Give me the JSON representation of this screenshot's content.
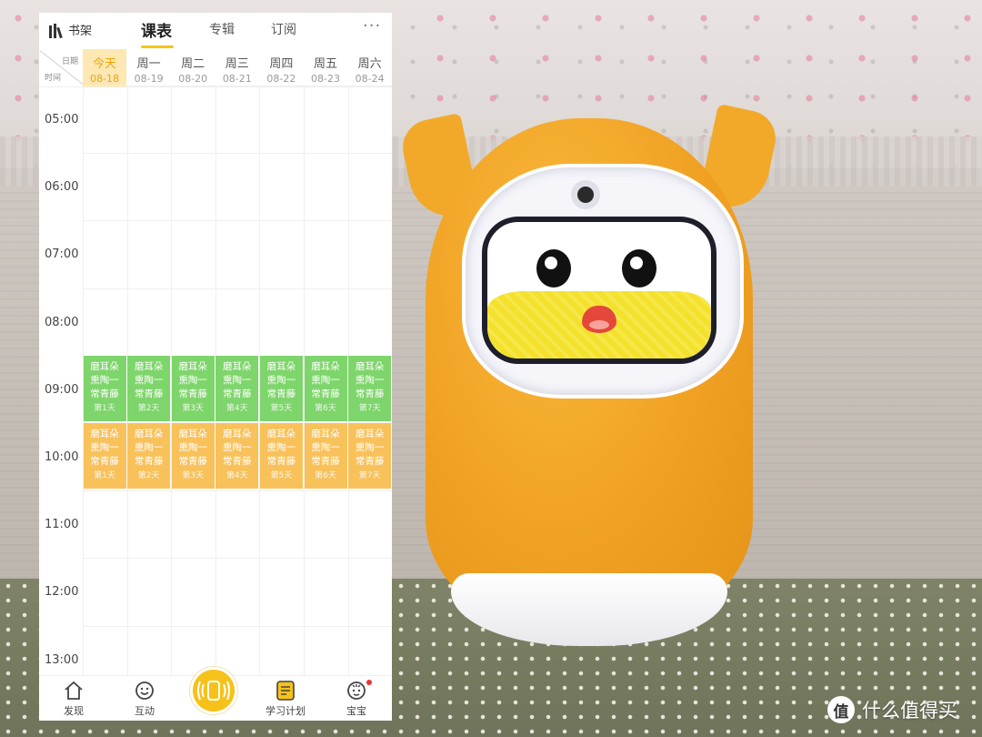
{
  "topbar": {
    "shelf_label": "书架",
    "tabs": [
      {
        "label": "课表",
        "active": true
      },
      {
        "label": "专辑",
        "active": false
      },
      {
        "label": "订阅",
        "active": false
      }
    ],
    "more_label": "···"
  },
  "corner": {
    "date_label": "日期",
    "time_label": "时间"
  },
  "days": [
    {
      "name": "今天",
      "date": "08-18",
      "today": true
    },
    {
      "name": "周一",
      "date": "08-19",
      "today": false
    },
    {
      "name": "周二",
      "date": "08-20",
      "today": false
    },
    {
      "name": "周三",
      "date": "08-21",
      "today": false
    },
    {
      "name": "周四",
      "date": "08-22",
      "today": false
    },
    {
      "name": "周五",
      "date": "08-23",
      "today": false
    },
    {
      "name": "周六",
      "date": "08-24",
      "today": false
    }
  ],
  "hours": [
    "05:00",
    "06:00",
    "07:00",
    "08:00",
    "09:00",
    "10:00",
    "11:00",
    "12:00",
    "13:00"
  ],
  "lessons": {
    "green": {
      "lines": [
        "磨耳朵",
        "熏陶一",
        "常青藤"
      ],
      "day_labels": [
        "第1天",
        "第2天",
        "第3天",
        "第4天",
        "第5天",
        "第6天",
        "第7天"
      ],
      "start_hour": "09:00",
      "color": "#7ed56b"
    },
    "orange": {
      "lines": [
        "磨耳朵",
        "熏陶一",
        "常青藤"
      ],
      "day_labels": [
        "第1天",
        "第2天",
        "第3天",
        "第4天",
        "第5天",
        "第6天",
        "第7天"
      ],
      "start_hour": "10:00",
      "color": "#f8c15a"
    }
  },
  "navbar": {
    "items": [
      {
        "label": "发现",
        "icon": "home-icon"
      },
      {
        "label": "互动",
        "icon": "smiley-chat-icon"
      },
      {
        "label": "",
        "icon": "speaker-broadcast-icon"
      },
      {
        "label": "学习计划",
        "icon": "study-plan-icon"
      },
      {
        "label": "宝宝",
        "icon": "baby-face-icon"
      }
    ]
  },
  "watermark": {
    "logo": "值",
    "text": "什么值得买"
  },
  "colors": {
    "accent": "#f5c518",
    "today_bg": "#fde8b3",
    "robot_orange": "#f0a123"
  }
}
